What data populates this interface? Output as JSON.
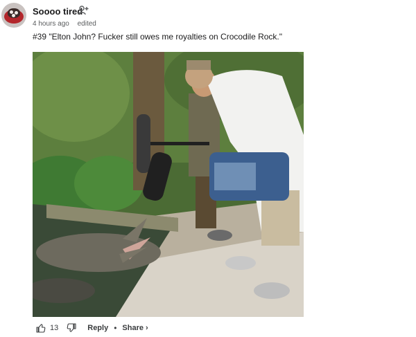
{
  "comment": {
    "username": "Soooo tired",
    "timestamp": "4 hours ago",
    "edited_label": "edited",
    "body": "#39 \"Elton John? Fucker still owes me royalties on Crocodile Rock.\"",
    "image_icon": "photo-of-crocodile-and-sound-recordists"
  },
  "actions": {
    "vote_count": "13",
    "reply_label": "Reply",
    "separator": "•",
    "share_label": "Share ›"
  },
  "colors": {
    "text": "#1a1a1b",
    "meta": "#5a5c5e",
    "actions": "#3a3c3e"
  }
}
